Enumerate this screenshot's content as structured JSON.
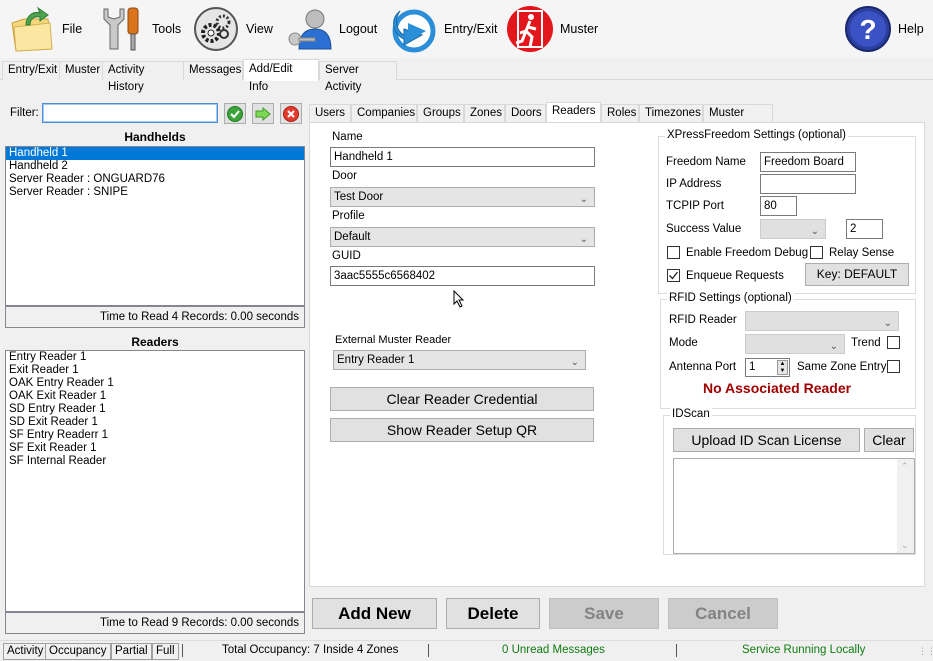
{
  "toolbar": {
    "items": [
      {
        "label": "File",
        "icon": "folder-icon"
      },
      {
        "label": "Tools",
        "icon": "tools-icon"
      },
      {
        "label": "View",
        "icon": "gears-icon"
      },
      {
        "label": "Logout",
        "icon": "user-key-icon"
      },
      {
        "label": "Entry/Exit",
        "icon": "arrow-circle-icon"
      },
      {
        "label": "Muster",
        "icon": "exit-sign-icon"
      },
      {
        "label": "Help",
        "icon": "help-icon"
      }
    ]
  },
  "main_tabs": [
    "Entry/Exit",
    "Muster",
    "Activity History",
    "Messages",
    "Add/Edit Info",
    "Server Activity"
  ],
  "main_tabs_active": "Add/Edit Info",
  "filter": {
    "label": "Filter:",
    "value": ""
  },
  "handhelds": {
    "title": "Handhelds",
    "items": [
      "Handheld 1",
      "Handheld 2",
      "Server Reader : ONGUARD76",
      "Server Reader : SNIPE"
    ],
    "selected": "Handheld 1",
    "status": "Time to Read 4 Records: 0.00 seconds"
  },
  "readers": {
    "title": "Readers",
    "items": [
      "Entry Reader 1",
      "Exit Reader 1",
      "OAK Entry Reader 1",
      "OAK Exit Reader 1",
      "SD Entry Reader 1",
      "SD Exit Reader 1",
      "SF Entry Readerr 1",
      "SF Exit Reader 1",
      "SF Internal Reader"
    ],
    "status": "Time to Read 9 Records: 0.00 seconds"
  },
  "sub_tabs": [
    "Users",
    "Companies",
    "Groups",
    "Zones",
    "Doors",
    "Readers",
    "Roles",
    "Timezones",
    "Muster Sites"
  ],
  "sub_tabs_active": "Readers",
  "form": {
    "name_label": "Name",
    "name_value": "Handheld 1",
    "door_label": "Door",
    "door_value": "Test Door",
    "profile_label": "Profile",
    "profile_value": "Default",
    "guid_label": "GUID",
    "guid_value": "3aac5555c6568402",
    "ext_muster_label": "External Muster Reader",
    "ext_muster_value": "Entry Reader 1",
    "clear_credential": "Clear Reader Credential",
    "show_qr": "Show Reader Setup QR"
  },
  "xpress": {
    "title": "XPressFreedom Settings (optional)",
    "freedom_name_label": "Freedom Name",
    "freedom_name_value": "Freedom Board",
    "ip_label": "IP Address",
    "ip_value": "",
    "port_label": "TCPIP Port",
    "port_value": "80",
    "success_label": "Success Value",
    "success_combo": "",
    "success_value": "2",
    "debug_label": "Enable Freedom Debug",
    "debug_checked": false,
    "relay_label": "Relay Sense",
    "relay_checked": false,
    "enqueue_label": "Enqueue Requests",
    "enqueue_checked": true,
    "key_button": "Key: DEFAULT"
  },
  "rfid": {
    "title": "RFID Settings (optional)",
    "reader_label": "RFID Reader",
    "reader_value": "",
    "mode_label": "Mode",
    "mode_value": "",
    "trend_label": "Trend",
    "antenna_label": "Antenna Port",
    "antenna_value": "1",
    "same_zone_label": "Same Zone Entry",
    "warning": "No Associated Reader",
    "warning_color": "#a00000"
  },
  "idscan": {
    "title": "IDScan",
    "upload": "Upload ID Scan License",
    "clear": "Clear",
    "text": ""
  },
  "actions": {
    "add_new": "Add New",
    "delete": "Delete",
    "save": "Save",
    "cancel": "Cancel"
  },
  "statusbar": {
    "buttons": [
      "Activity",
      "Occupancy",
      "Partial",
      "Full"
    ],
    "occupancy": "Total Occupancy: 7 Inside 4 Zones",
    "messages": "0 Unread Messages",
    "service": "Service Running Locally",
    "status_color": "#107c10"
  }
}
